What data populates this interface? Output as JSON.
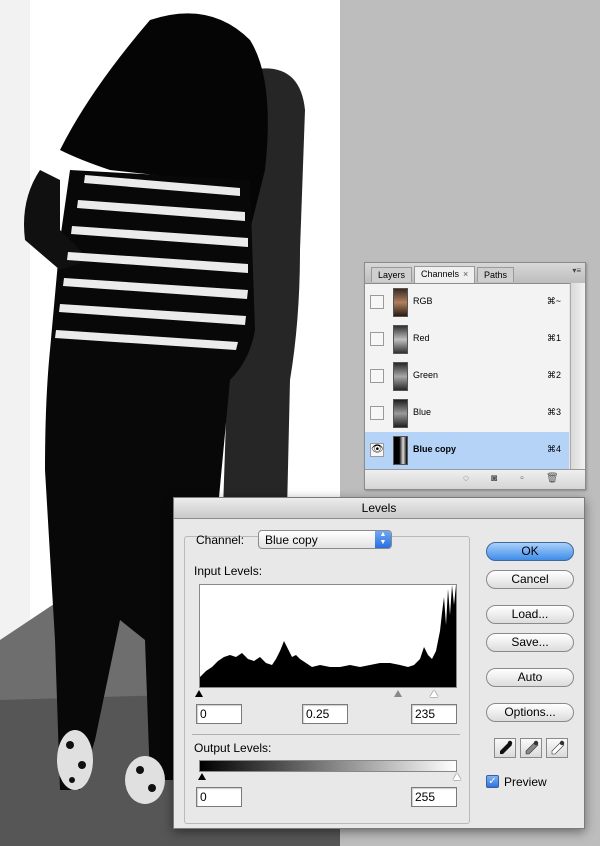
{
  "channels_panel": {
    "tabs": [
      {
        "label": "Layers"
      },
      {
        "label": "Channels",
        "close": "×"
      },
      {
        "label": "Paths"
      }
    ],
    "menu_glyph": "▾≡",
    "rows": [
      {
        "name": "RGB",
        "shortcut": "⌘~",
        "visible": false
      },
      {
        "name": "Red",
        "shortcut": "⌘1",
        "visible": false
      },
      {
        "name": "Green",
        "shortcut": "⌘2",
        "visible": false
      },
      {
        "name": "Blue",
        "shortcut": "⌘3",
        "visible": false
      },
      {
        "name": "Blue copy",
        "shortcut": "⌘4",
        "visible": true,
        "selected": true
      }
    ],
    "eye_glyph": "👁"
  },
  "levels_dialog": {
    "title": "Levels",
    "channel_label": "Channel:",
    "channel_value": "Blue copy",
    "input_levels_label": "Input Levels:",
    "input_black": "0",
    "input_gamma": "0.25",
    "input_white": "235",
    "output_levels_label": "Output Levels:",
    "output_black": "0",
    "output_white": "255",
    "buttons": {
      "ok": "OK",
      "cancel": "Cancel",
      "load": "Load...",
      "save": "Save...",
      "auto": "Auto",
      "options": "Options..."
    },
    "preview_label": "Preview",
    "preview_checked": true,
    "accent_color": "#3f8de9"
  }
}
